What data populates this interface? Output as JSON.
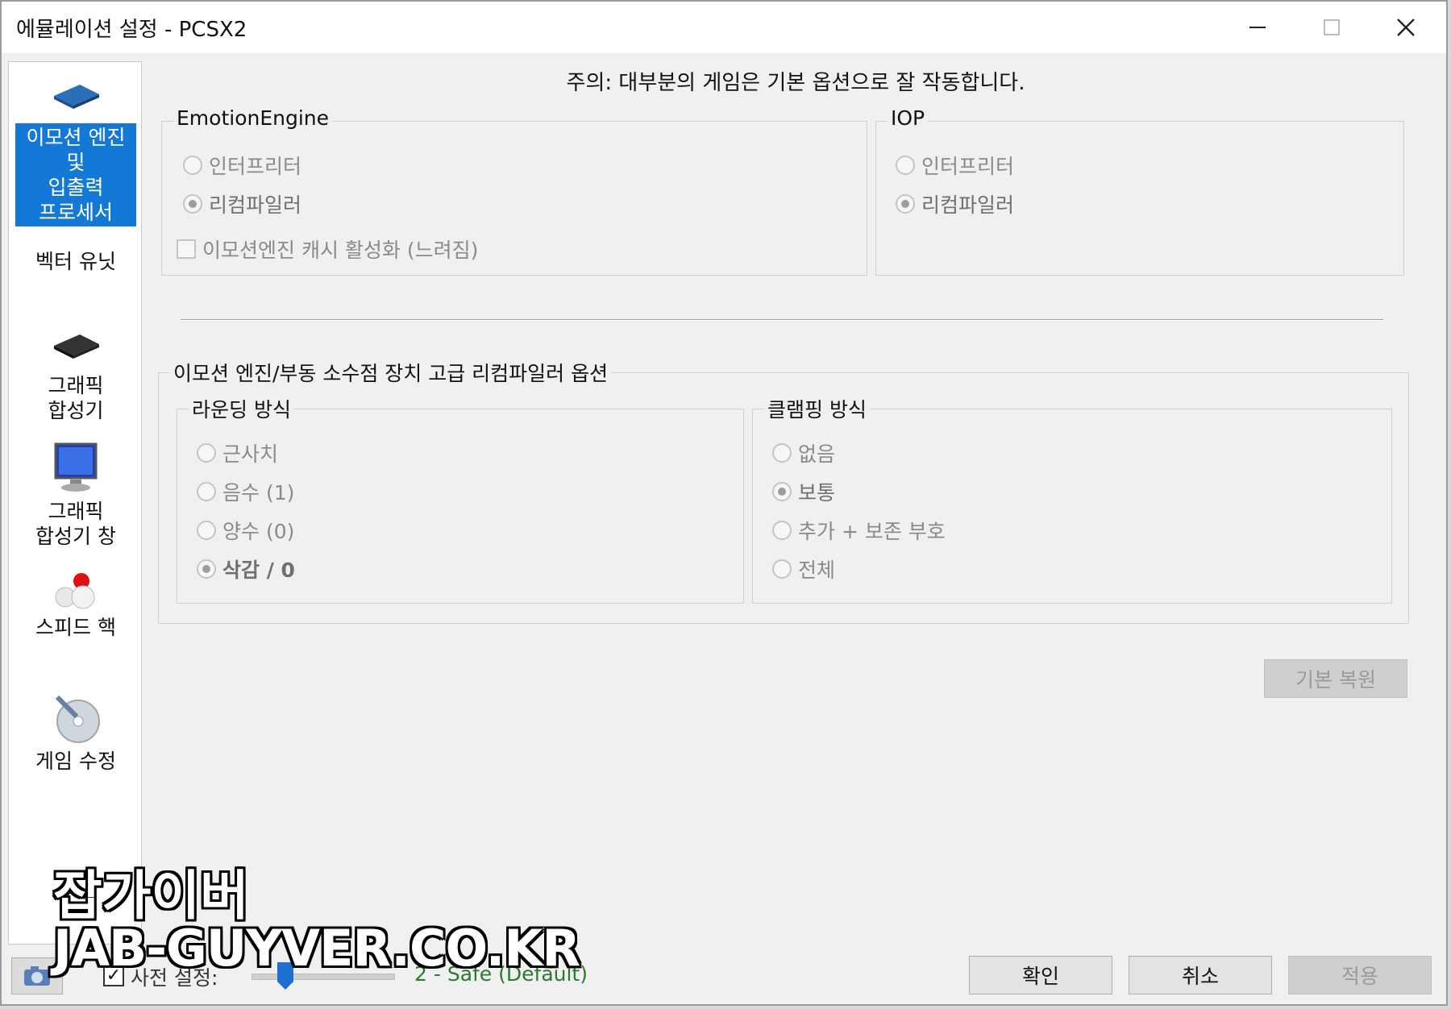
{
  "window": {
    "title": "에뮬레이션 설정 - PCSX2"
  },
  "titlebar": {
    "minimize_icon": "minimize-icon",
    "maximize_icon": "maximize-icon",
    "close_icon": "close-icon"
  },
  "sidebar": {
    "items": [
      {
        "label": "이모션 엔진\n및\n입출력\n프로세서",
        "icon": "cpu-chip-icon",
        "selected": true
      },
      {
        "label": "벡터 유닛",
        "icon": "vector-unit-icon",
        "selected": false
      },
      {
        "label": "그래픽\n합성기",
        "icon": "gpu-chip-icon",
        "selected": false
      },
      {
        "label": "그래픽\n합성기 창",
        "icon": "monitor-icon",
        "selected": false
      },
      {
        "label": "스피드 핵",
        "icon": "speed-hack-icon",
        "selected": false
      },
      {
        "label": "게임 수정",
        "icon": "disc-fix-icon",
        "selected": false
      }
    ]
  },
  "main": {
    "note": "주의: 대부분의 게임은 기본 옵션으로 잘 작동합니다.",
    "emotion_engine": {
      "title": "EmotionEngine",
      "options": [
        "인터프리터",
        "리컴파일러"
      ],
      "selected": "리컴파일러",
      "cache_checkbox": "이모션엔진 캐시 활성화 (느려짐)"
    },
    "iop": {
      "title": "IOP",
      "options": [
        "인터프리터",
        "리컴파일러"
      ],
      "selected": "리컴파일러"
    },
    "advanced": {
      "title": "이모션 엔진/부동 소수점 장치 고급 리컴파일러 옵션",
      "rounding": {
        "title": "라운딩 방식",
        "options": [
          "근사치",
          "음수 (1)",
          "양수 (0)",
          "삭감 / 0"
        ],
        "selected": "삭감 / 0"
      },
      "clamping": {
        "title": "클램핑 방식",
        "options": [
          "없음",
          "보통",
          "추가 + 보존 부호",
          "전체"
        ],
        "selected": "보통"
      }
    },
    "restore_defaults": "기본 복원"
  },
  "footer": {
    "preset_label": "사전 설정:",
    "preset_checked": true,
    "preset_value": "2 - Safe (Default)",
    "ok": "확인",
    "cancel": "취소",
    "apply": "적용"
  },
  "watermark": {
    "line1": "잡가이버",
    "line2": "JAB-GUYVER.CO.KR"
  }
}
